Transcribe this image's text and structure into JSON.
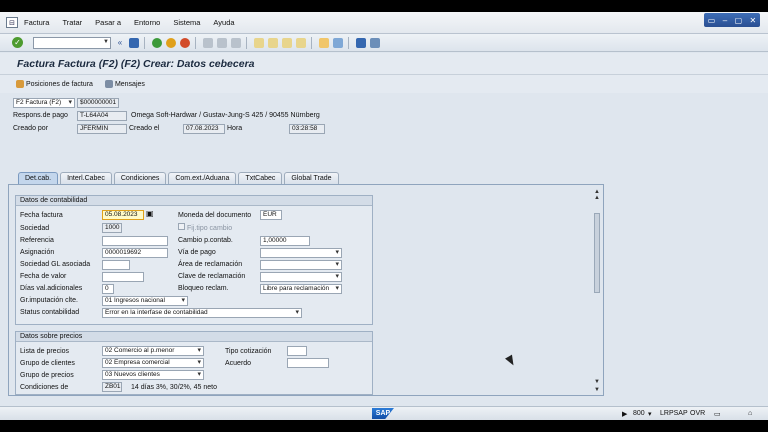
{
  "menu": {
    "items": [
      "Factura",
      "Tratar",
      "Pasar a",
      "Entorno",
      "Sistema",
      "Ayuda"
    ]
  },
  "window_controls": [
    "▭",
    "–",
    "▢",
    "✕"
  ],
  "toolbar": {
    "command_value": ""
  },
  "title": "Factura Factura (F2)  (F2) Crear: Datos cebecera",
  "app_toolbar": {
    "positions_label": "Posiciones de factura",
    "messages_label": "Mensajes"
  },
  "header": {
    "doc_type": "F2 Factura (F2)",
    "doc_number": "$000000001",
    "payer_label": "Respons.de pago",
    "payer_value": "T-L64A04",
    "payer_address": "Omega Soft-Hardwar / Gustav-Jung-S 425 / 90455 Nürnberg",
    "created_by_label": "Creado por",
    "created_by_value": "JFERMIN",
    "created_on_label": "Creado el",
    "created_on_value": "07.08.2023",
    "time_label": "Hora",
    "time_value": "03:28:58"
  },
  "tabs": [
    "Det.cab.",
    "Interl.Cabec",
    "Condiciones",
    "Com.ext./Aduana",
    "TxtCabec",
    "Global Trade"
  ],
  "accounting": {
    "title": "Datos de contabilidad",
    "invoice_date_label": "Fecha factura",
    "invoice_date_value": "05.08.2023",
    "currency_label": "Moneda del documento",
    "currency_value": "EUR",
    "company_label": "Sociedad",
    "company_value": "1000",
    "fixed_rate_label": "Fij.tipo cambio",
    "reference_label": "Referencia",
    "reference_value": "",
    "exchange_label": "Cambio p.contab.",
    "exchange_value": "1,00000",
    "assignment_label": "Asignación",
    "assignment_value": "0000019692",
    "payment_way_label": "Vía de pago",
    "payment_way_value": "",
    "gl_company_label": "Sociedad GL asociada",
    "gl_company_value": "",
    "claim_area_label": "Área de reclamación",
    "claim_area_value": "",
    "value_date_label": "Fecha de valor",
    "value_date_value": "",
    "claim_key_label": "Clave de reclamación",
    "claim_key_value": "",
    "extra_days_label": "Días val.adicionales",
    "extra_days_value": "0",
    "claim_block_label": "Bloqueo reclam.",
    "claim_block_value": "Libre para reclamación",
    "imput_group_label": "Gr.imputación clte.",
    "imput_group_value": "01 Ingresos nacional",
    "status_label": "Status contabilidad",
    "status_value": "Error en la interfase de contabilidad"
  },
  "prices": {
    "title": "Datos sobre precios",
    "price_list_label": "Lista de precios",
    "price_list_value": "02 Comercio al p.menor",
    "quote_type_label": "Tipo cotización",
    "quote_type_value": "",
    "customer_group_label": "Grupo de clientes",
    "customer_group_value": "02 Empresa comercial",
    "agreement_label": "Acuerdo",
    "agreement_value": "",
    "price_group_label": "Grupo de precios",
    "price_group_value": "03 Nuevos clientes",
    "conditions_label": "Condiciones de",
    "conditions_value": "ZB01",
    "conditions_text": "14 días 3%, 30/2%, 45 neto"
  },
  "status_bar": {
    "logo": "SAP",
    "client": "800",
    "server": "LRPSAP",
    "mode": "OVR"
  }
}
